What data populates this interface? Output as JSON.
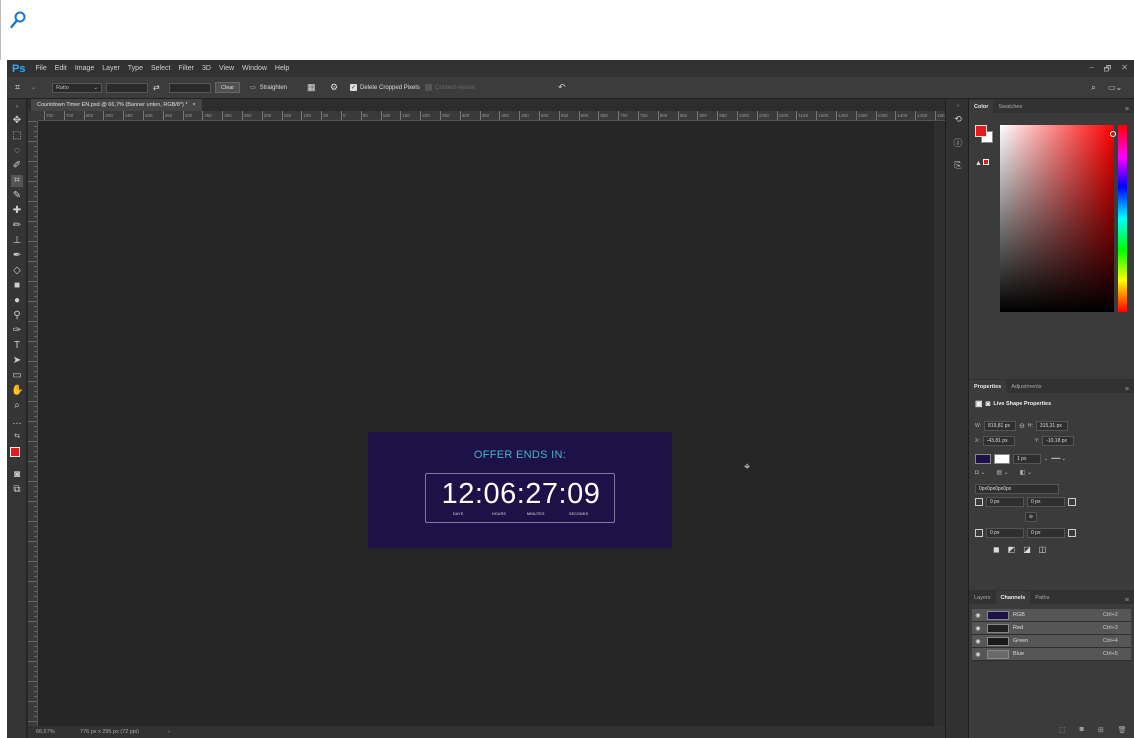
{
  "top_strip": {
    "icon": "search-icon"
  },
  "menubar": {
    "logo": "Ps",
    "items": [
      "File",
      "Edit",
      "Image",
      "Layer",
      "Type",
      "Select",
      "Filter",
      "3D",
      "View",
      "Window",
      "Help"
    ],
    "window_controls": [
      "–",
      "🗗",
      "✕"
    ]
  },
  "options_bar": {
    "ratio_label": "Ratio",
    "clear_label": "Clear",
    "straighten_label": "Straighten",
    "delete_cropped_label": "Delete Cropped Pixels",
    "content_aware_label": "Content-Aware",
    "delete_cropped_checked": true
  },
  "document": {
    "tab_title": "Countdown Timer EN.psd @ 66,7% (Banner unten, RGB/8*) *",
    "tab_close": "×",
    "ruler_labels": [
      "750",
      "700",
      "650",
      "600",
      "550",
      "500",
      "450",
      "400",
      "350",
      "300",
      "250",
      "200",
      "150",
      "100",
      "50",
      "0",
      "50",
      "100",
      "150",
      "200",
      "250",
      "300",
      "350",
      "400",
      "450",
      "500",
      "550",
      "600",
      "650",
      "700",
      "750",
      "800",
      "850",
      "900",
      "950",
      "1000",
      "1050",
      "1100",
      "1150",
      "1200",
      "1250",
      "1300",
      "1350",
      "1400",
      "1450",
      "150"
    ]
  },
  "banner": {
    "heading": "OFFER ENDS IN:",
    "timer": "12:06:27:09",
    "labels": [
      "DAYS",
      "HOURS",
      "MINUTES",
      "SECONDS"
    ],
    "background_color": "#1e1148",
    "accent_color": "#3fb6c8"
  },
  "status": {
    "zoom": "66,67%",
    "doc_size": "776 px x 295 px (72 ppi)",
    "arrow": "›"
  },
  "color_panel": {
    "tabs": [
      "Color",
      "Swatches"
    ],
    "foreground": "#e31b1b",
    "background": "#ffffff"
  },
  "properties_panel": {
    "tabs": [
      "Properties",
      "Adjustments"
    ],
    "title": "Live Shape Properties",
    "w_label": "W:",
    "w_value": "819,81 px",
    "h_label": "H:",
    "h_value": "315,31 px",
    "x_label": "X:",
    "x_value": "-43,81 px",
    "y_label": "Y:",
    "y_value": "-10,18 px",
    "stroke_width": "1 px",
    "radius_summary": "0px0px0px0px",
    "corner_tl": "0 px",
    "corner_tr": "0 px",
    "corner_bl": "0 px",
    "corner_br": "0 px"
  },
  "channels_panel": {
    "tabs": [
      "Layers",
      "Channels",
      "Paths"
    ],
    "channels": [
      {
        "name": "RGB",
        "shortcut": "Ctrl+2"
      },
      {
        "name": "Red",
        "shortcut": "Ctrl+3"
      },
      {
        "name": "Green",
        "shortcut": "Ctrl+4"
      },
      {
        "name": "Blue",
        "shortcut": "Ctrl+5"
      }
    ]
  }
}
